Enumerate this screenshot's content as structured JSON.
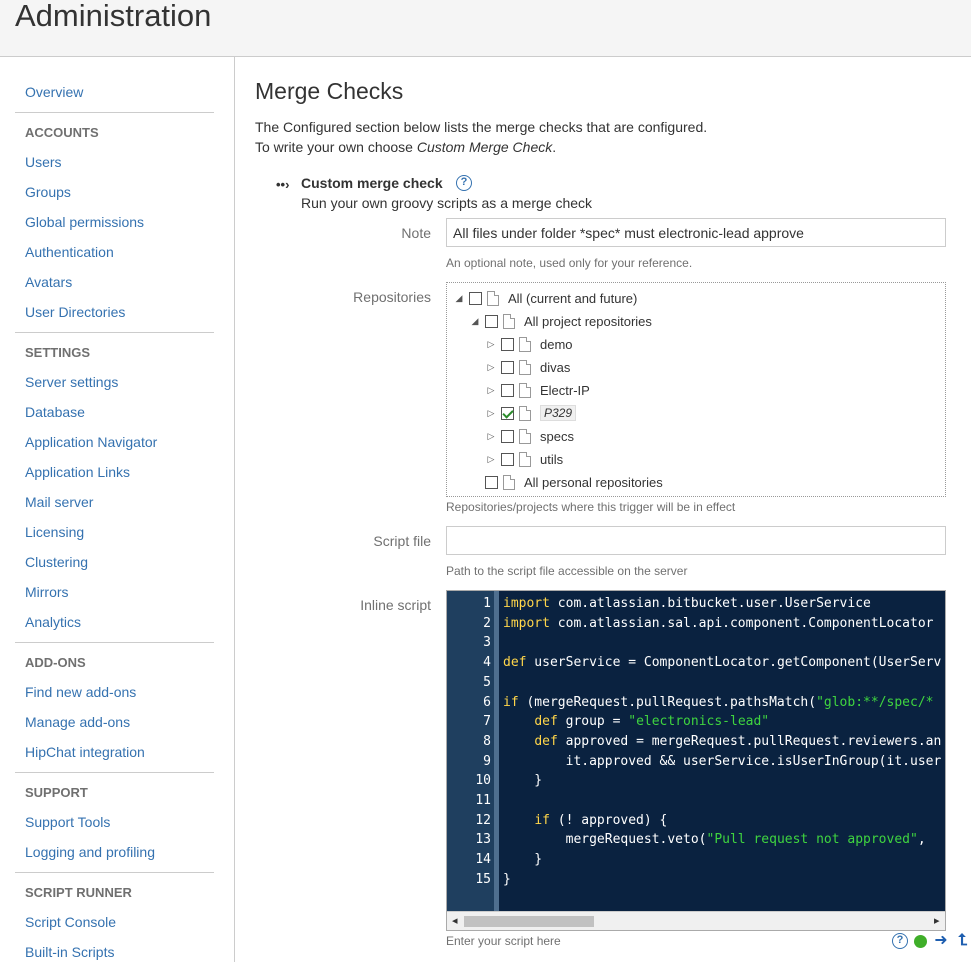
{
  "header": {
    "title": "Administration"
  },
  "sidebar": {
    "overview": "Overview",
    "sections": [
      {
        "heading": "ACCOUNTS",
        "items": [
          "Users",
          "Groups",
          "Global permissions",
          "Authentication",
          "Avatars",
          "User Directories"
        ]
      },
      {
        "heading": "SETTINGS",
        "items": [
          "Server settings",
          "Database",
          "Application Navigator",
          "Application Links",
          "Mail server",
          "Licensing",
          "Clustering",
          "Mirrors",
          "Analytics"
        ]
      },
      {
        "heading": "ADD-ONS",
        "items": [
          "Find new add-ons",
          "Manage add-ons",
          "HipChat integration"
        ]
      },
      {
        "heading": "SUPPORT",
        "items": [
          "Support Tools",
          "Logging and profiling"
        ]
      },
      {
        "heading": "SCRIPT RUNNER",
        "items": [
          "Script Console",
          "Built-in Scripts"
        ]
      }
    ]
  },
  "main": {
    "title": "Merge Checks",
    "intro_line1": "The Configured section below lists the merge checks that are configured.",
    "intro_line2_prefix": "To write your own choose ",
    "intro_line2_em": "Custom Merge Check",
    "intro_line2_suffix": ".",
    "check": {
      "expander": "••›",
      "title": "Custom merge check",
      "help": "?",
      "description": "Run your own groovy scripts as a merge check"
    },
    "note": {
      "label": "Note",
      "value": "All files under folder *spec* must electronic-lead approve",
      "hint": "An optional note, used only for your reference."
    },
    "repositories": {
      "label": "Repositories",
      "hint": "Repositories/projects where this trigger will be in effect",
      "tree": {
        "all": "All (current and future)",
        "all_projects": "All project repositories",
        "projects": [
          {
            "name": "demo",
            "checked": false
          },
          {
            "name": "divas",
            "checked": false
          },
          {
            "name": "Electr-IP",
            "checked": false
          },
          {
            "name": "P329",
            "checked": true
          },
          {
            "name": "specs",
            "checked": false
          },
          {
            "name": "utils",
            "checked": false
          }
        ],
        "all_personal": "All personal repositories",
        "expanded_glyph": "◢",
        "collapsed_glyph": "▷"
      }
    },
    "script_file": {
      "label": "Script file",
      "value": "",
      "hint": "Path to the script file accessible on the server"
    },
    "inline_script": {
      "label": "Inline script",
      "hint": "Enter your script here",
      "line_numbers": [
        "1",
        "2",
        "3",
        "4",
        "5",
        "6",
        "7",
        "8",
        "9",
        "10",
        "11",
        "12",
        "13",
        "14",
        "15"
      ],
      "lines": [
        [
          [
            "kw",
            "import"
          ],
          [
            "t",
            " com.atlassian.bitbucket.user.UserService"
          ]
        ],
        [
          [
            "kw",
            "import"
          ],
          [
            "t",
            " com.atlassian.sal.api.component.ComponentLocator"
          ]
        ],
        [],
        [
          [
            "kw",
            "def"
          ],
          [
            "t",
            " userService = ComponentLocator.getComponent(UserServ"
          ]
        ],
        [],
        [
          [
            "kw",
            "if"
          ],
          [
            "t",
            " (mergeRequest.pullRequest.pathsMatch("
          ],
          [
            "str",
            "\"glob:**/spec/*"
          ]
        ],
        [
          [
            "t",
            "    "
          ],
          [
            "kw",
            "def"
          ],
          [
            "t",
            " group = "
          ],
          [
            "str",
            "\"electronics-lead\""
          ]
        ],
        [
          [
            "t",
            "    "
          ],
          [
            "kw",
            "def"
          ],
          [
            "t",
            " approved = mergeRequest.pullRequest.reviewers.an"
          ]
        ],
        [
          [
            "t",
            "        it.approved && userService.isUserInGroup(it.user"
          ]
        ],
        [
          [
            "t",
            "    }"
          ]
        ],
        [],
        [
          [
            "t",
            "    "
          ],
          [
            "kw",
            "if"
          ],
          [
            "t",
            " (! approved) {"
          ]
        ],
        [
          [
            "t",
            "        mergeRequest.veto("
          ],
          [
            "str",
            "\"Pull request not approved\""
          ],
          [
            "t",
            ","
          ]
        ],
        [
          [
            "t",
            "    }"
          ]
        ],
        [
          [
            "t",
            "}"
          ]
        ]
      ],
      "scroll_left": "◂",
      "scroll_right": "▸",
      "tools": {
        "help": "?",
        "next": "➜",
        "up": "⮤"
      }
    }
  }
}
